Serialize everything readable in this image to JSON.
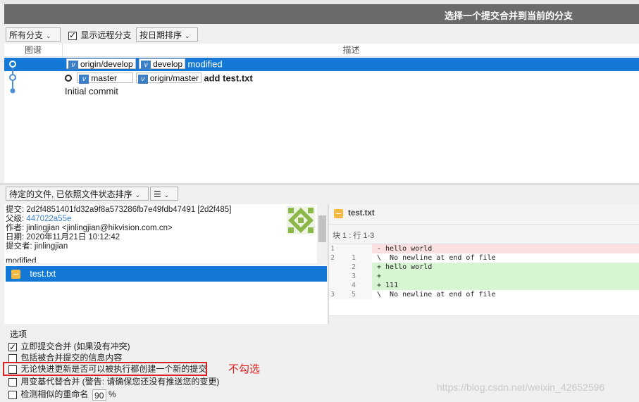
{
  "header": {
    "title": "选择一个提交合并到当前的分支"
  },
  "toolbar": {
    "branch_filter": "所有分支",
    "show_remote_label": "显示远程分支",
    "show_remote_checked": true,
    "sort_label": "按日期排序"
  },
  "graph": {
    "columns": {
      "graph": "图谱",
      "description": "描述"
    },
    "rows": [
      {
        "tags": [
          "origin/develop",
          "develop"
        ],
        "message": "modified",
        "selected": true
      },
      {
        "tags": [
          "master",
          "origin/master"
        ],
        "message": "add test.txt",
        "selected": false
      },
      {
        "tags": [],
        "message": "Initial commit",
        "selected": false
      }
    ]
  },
  "file_toolbar": {
    "pending_label": "待定的文件, 已依照文件状态排序"
  },
  "commit": {
    "commit_label": "提交:",
    "commit_value": "2d2f4851401fd32a9f8a573286fb7e49fdb47491 [2d2f485]",
    "parent_label": "父级:",
    "parent_value": "447022a55e",
    "author_label": "作者:",
    "author_value": "jinlingjian <jinlingjian@hikvision.com.cn>",
    "date_label": "日期:",
    "date_value": "2020年11月21日 10:12:42",
    "committer_label": "提交者:",
    "committer_value": "jinlingjian",
    "message_partial": "modified"
  },
  "files": [
    {
      "name": "test.txt",
      "selected": true
    }
  ],
  "diff": {
    "file_name": "test.txt",
    "hunk_header": "块 1 : 行 1-3",
    "lines": [
      {
        "old": "1",
        "new": "",
        "text": "- hello world",
        "type": "del"
      },
      {
        "old": "2",
        "new": "1",
        "text": "\\  No newline at end of file",
        "type": "ctx"
      },
      {
        "old": "",
        "new": "2",
        "text": "+ hello world",
        "type": "add"
      },
      {
        "old": "",
        "new": "3",
        "text": "+",
        "type": "add"
      },
      {
        "old": "",
        "new": "4",
        "text": "+ 111",
        "type": "add"
      },
      {
        "old": "3",
        "new": "5",
        "text": "\\  No newline at end of file",
        "type": "ctx"
      }
    ]
  },
  "options": {
    "title": "选项",
    "items": [
      {
        "label": "立即提交合并 (如果没有冲突)",
        "checked": true
      },
      {
        "label": "包括被合并提交的信息内容",
        "checked": false
      },
      {
        "label": "无论快进更新是否可以被执行都创建一个新的提交",
        "checked": false,
        "highlighted": true
      },
      {
        "label": "用变基代替合并 (警告: 请确保您还没有推送您的变更)",
        "checked": false
      },
      {
        "label": "检测相似的重命名",
        "checked": false,
        "value": "90",
        "unit": "%"
      }
    ]
  },
  "annotation": {
    "text": "不勾选",
    "color": "#e02020"
  },
  "watermark": "https://blog.csdn.net/weixin_42652596",
  "colors": {
    "selection": "#1479d6",
    "header": "#6a6a6a",
    "add_bg": "#d7f5d3",
    "del_bg": "#fbe0e0"
  }
}
